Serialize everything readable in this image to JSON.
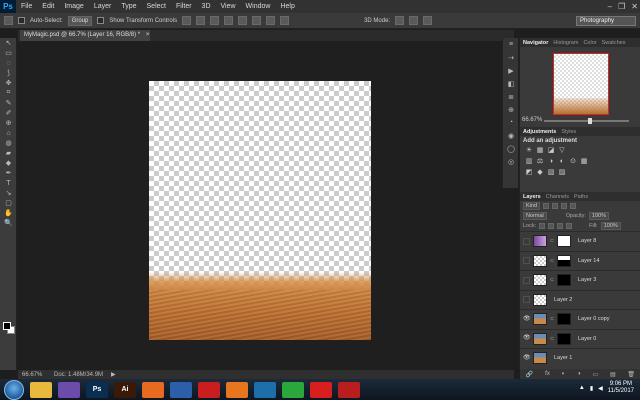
{
  "app": {
    "logo": "Ps",
    "workspace": "Photography"
  },
  "menu": [
    "File",
    "Edit",
    "Image",
    "Layer",
    "Type",
    "Select",
    "Filter",
    "3D",
    "View",
    "Window",
    "Help"
  ],
  "window_controls": [
    "–",
    "❐",
    "✕"
  ],
  "options_bar": {
    "auto_select_label": "Auto-Select:",
    "auto_select_value": "Group",
    "transform_label": "Show Transform Controls",
    "mode_3d_label": "3D Mode:"
  },
  "document": {
    "tab_title": "MyMagic.psd @ 66.7% (Layer 16, RGB/8) *",
    "close_glyph": "×"
  },
  "status": {
    "zoom": "66.67%",
    "doc_info": "Doc: 1.48M/34.9M",
    "arrow": "▶"
  },
  "navigator": {
    "tabs": [
      "Navigator",
      "Histogram",
      "Color",
      "Swatches"
    ],
    "zoom": "66.67%"
  },
  "adjustments": {
    "tabs": [
      "Adjustments",
      "Styles"
    ],
    "title": "Add an adjustment"
  },
  "layers_panel": {
    "tabs": [
      "Layers",
      "Channels",
      "Paths"
    ],
    "filter": "Kind",
    "blend": "Normal",
    "opacity_label": "Opacity:",
    "opacity": "100%",
    "lock_label": "Lock:",
    "fill_label": "Fill:",
    "fill": "100%",
    "layers": [
      {
        "name": "Layer 8",
        "visible": false,
        "thumb": "t-purple",
        "mask": "t-mask-w"
      },
      {
        "name": "Layer 14",
        "visible": false,
        "thumb": "t-check",
        "mask": "t-mask-mix"
      },
      {
        "name": "Layer 3",
        "visible": false,
        "thumb": "t-check",
        "mask": "t-mask-b"
      },
      {
        "name": "Layer 2",
        "visible": false,
        "thumb": "t-check",
        "mask": ""
      },
      {
        "name": "Layer 0 copy",
        "visible": true,
        "thumb": "t-photo",
        "mask": "t-mask-b"
      },
      {
        "name": "Layer 0",
        "visible": true,
        "thumb": "t-photo",
        "mask": "t-mask-b"
      },
      {
        "name": "Layer 1",
        "visible": true,
        "thumb": "t-photo",
        "mask": ""
      }
    ],
    "bottom_icons": [
      "🔗",
      "fx",
      "◐",
      "◑",
      "▭",
      "▤",
      "🗑"
    ]
  },
  "tools": [
    "↖",
    "▭",
    "◌",
    "⟆",
    "✥",
    "⌗",
    "✎",
    "✐",
    "⊕",
    "⌂",
    "◍",
    "▰",
    "◆",
    "✒",
    "T",
    "↘",
    "▢",
    "✋",
    "🔍"
  ],
  "dock_icons": [
    "≡",
    "⇢",
    "▶",
    "◧",
    "≣",
    "⊕",
    "◔",
    "◉",
    "◯",
    "◎"
  ],
  "adjust_icons": [
    [
      "☀",
      "▦",
      "◪",
      "▽"
    ],
    [
      "▥",
      "⚖",
      "◑",
      "◐",
      "⊙",
      "▦"
    ],
    [
      "◩",
      "◆",
      "▧",
      "▨"
    ]
  ],
  "taskbar": {
    "apps": [
      {
        "name": "explorer",
        "label": "",
        "color": "#e8b93c"
      },
      {
        "name": "media",
        "label": "",
        "color": "#6b4ca8"
      },
      {
        "name": "photoshop",
        "label": "Ps",
        "color": "#0a2e52"
      },
      {
        "name": "illustrator",
        "label": "Ai",
        "color": "#3a1a06"
      },
      {
        "name": "firefox",
        "label": "",
        "color": "#e86a1e"
      },
      {
        "name": "virtualbox",
        "label": "",
        "color": "#2c5fa8"
      },
      {
        "name": "acrobat",
        "label": "",
        "color": "#c81e1e"
      },
      {
        "name": "xampp",
        "label": "",
        "color": "#e8761e"
      },
      {
        "name": "mysql",
        "label": "",
        "color": "#1c6fa8"
      },
      {
        "name": "green-app",
        "label": "",
        "color": "#2aa83c"
      },
      {
        "name": "red-app",
        "label": "",
        "color": "#d81e1e"
      },
      {
        "name": "filezilla",
        "label": "",
        "color": "#b81e1e"
      }
    ],
    "time": "9:06 PM",
    "date": "11/5/2017"
  }
}
